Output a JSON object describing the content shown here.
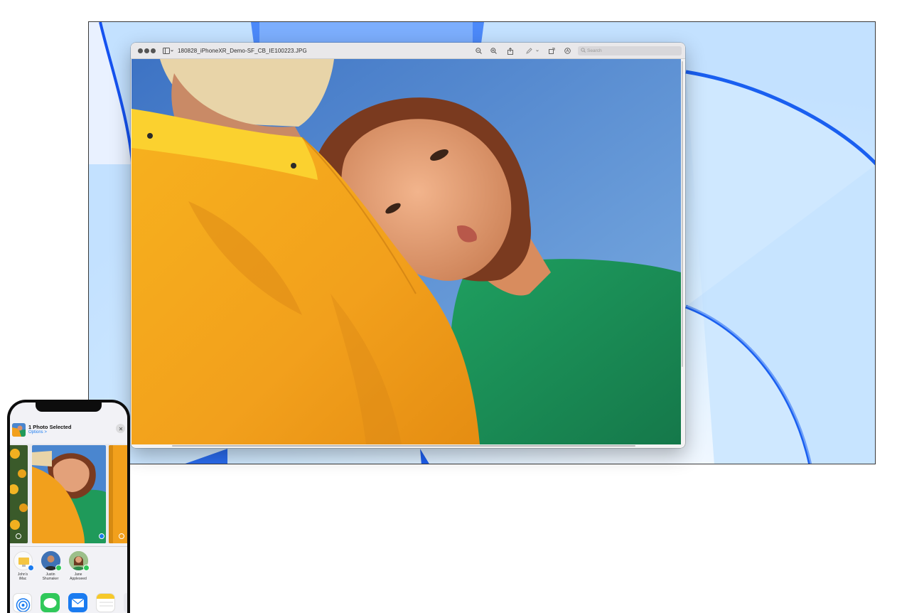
{
  "desktop": {
    "wallpaper": "macOS Monterey blue wallpaper"
  },
  "preview_window": {
    "filename": "180828_iPhoneXR_Demo-SF_CB_IE100223.JPG",
    "search_placeholder": "Search",
    "toolbar_icons": [
      "sidebar-icon",
      "zoom-out-icon",
      "zoom-in-icon",
      "share-icon",
      "markup-pen-icon",
      "rotate-icon",
      "markup-toolbar-icon",
      "search-icon"
    ],
    "photo_subject": "person in yellow jacket with woman in green sweater resting head on shoulder, blue sky"
  },
  "iphone": {
    "share_sheet": {
      "title": "1 Photo Selected",
      "options_label": "Options",
      "options_chevron": ">",
      "airdrop_people": [
        {
          "name_line1": "John's",
          "name_line2": "iMac"
        },
        {
          "name_line1": "Justin",
          "name_line2": "Shumaker"
        },
        {
          "name_line1": "Jane",
          "name_line2": "Appleseed"
        }
      ],
      "apps": [
        "airdrop-icon",
        "messages-icon",
        "mail-icon",
        "notes-icon"
      ]
    }
  },
  "colors": {
    "accent_blue": "#1a7bf0",
    "wallpaper_blue": "#1d5ff0",
    "jacket_yellow": "#f5a81a",
    "sweater_green": "#1f9a5a",
    "sky_blue": "#4a86cf"
  }
}
